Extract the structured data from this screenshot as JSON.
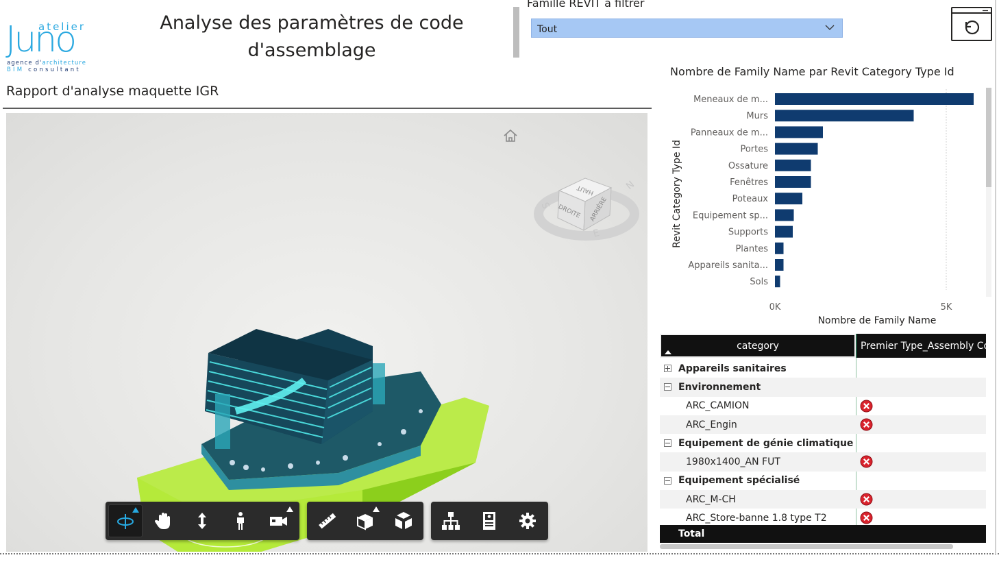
{
  "logo": {
    "line1": "atelier",
    "line2": "Juno",
    "tagline_a": "agence d'",
    "tagline_b": "architecture",
    "tagline2_a": "BIM",
    "tagline2_b": " consultant"
  },
  "header": {
    "title": "Analyse des paramètres de code d'assemblage",
    "subtitle": "Rapport d'analyse maquette IGR"
  },
  "slicer": {
    "label": "Famille REVIT à filtrer",
    "value": "Tout"
  },
  "reset_button": {
    "icon": "reset-icon"
  },
  "viewer": {
    "viewcube_labels": {
      "top": "HAUT",
      "left": "DROITE",
      "right": "ARRIÈRE"
    },
    "compass": {
      "s": "S",
      "n": "N",
      "e": "E"
    },
    "toolbar_groups": [
      [
        "orbit-icon",
        "pan-icon",
        "zoom-icon",
        "first-person-icon",
        "camera-icon"
      ],
      [
        "measure-icon",
        "section-icon",
        "explode-icon"
      ],
      [
        "model-browser-icon",
        "properties-icon",
        "settings-icon"
      ]
    ]
  },
  "chart_data": {
    "type": "bar",
    "orientation": "horizontal",
    "title": "Nombre de Family Name par Revit Category Type Id",
    "xlabel": "Nombre de Family Name",
    "ylabel": "Revit Category Type Id",
    "categories": [
      "Meneaux de m...",
      "Murs",
      "Panneaux de m...",
      "Portes",
      "Ossature",
      "Fenêtres",
      "Poteaux",
      "Equipement sp...",
      "Supports",
      "Plantes",
      "Appareils sanita...",
      "Sols"
    ],
    "values": [
      5800,
      4050,
      1400,
      1250,
      1050,
      1050,
      800,
      550,
      520,
      250,
      250,
      150
    ],
    "xlim": [
      0,
      6000
    ],
    "xticks": [
      "0K",
      "5K"
    ],
    "color": "#0f3b6f",
    "grid": true
  },
  "matrix": {
    "col1": "category",
    "col2": "Premier Type_Assembly Code",
    "rows": [
      {
        "kind": "group",
        "expanded": false,
        "label": "Appareils sanitaires"
      },
      {
        "kind": "group",
        "expanded": true,
        "label": "Environnement"
      },
      {
        "kind": "leaf",
        "label": "ARC_CAMION",
        "status": "error"
      },
      {
        "kind": "leaf",
        "label": "ARC_Engin",
        "status": "error"
      },
      {
        "kind": "group",
        "expanded": true,
        "label": "Equipement de génie climatique"
      },
      {
        "kind": "leaf",
        "label": "1980x1400_AN FUT",
        "status": "error"
      },
      {
        "kind": "group",
        "expanded": true,
        "label": "Equipement spécialisé"
      },
      {
        "kind": "leaf",
        "label": "ARC_M-CH",
        "status": "error"
      },
      {
        "kind": "leaf",
        "label": "ARC_Store-banne 1.8 type T2",
        "status": "error"
      }
    ],
    "total": "Total",
    "error_color": "#d9232d"
  }
}
